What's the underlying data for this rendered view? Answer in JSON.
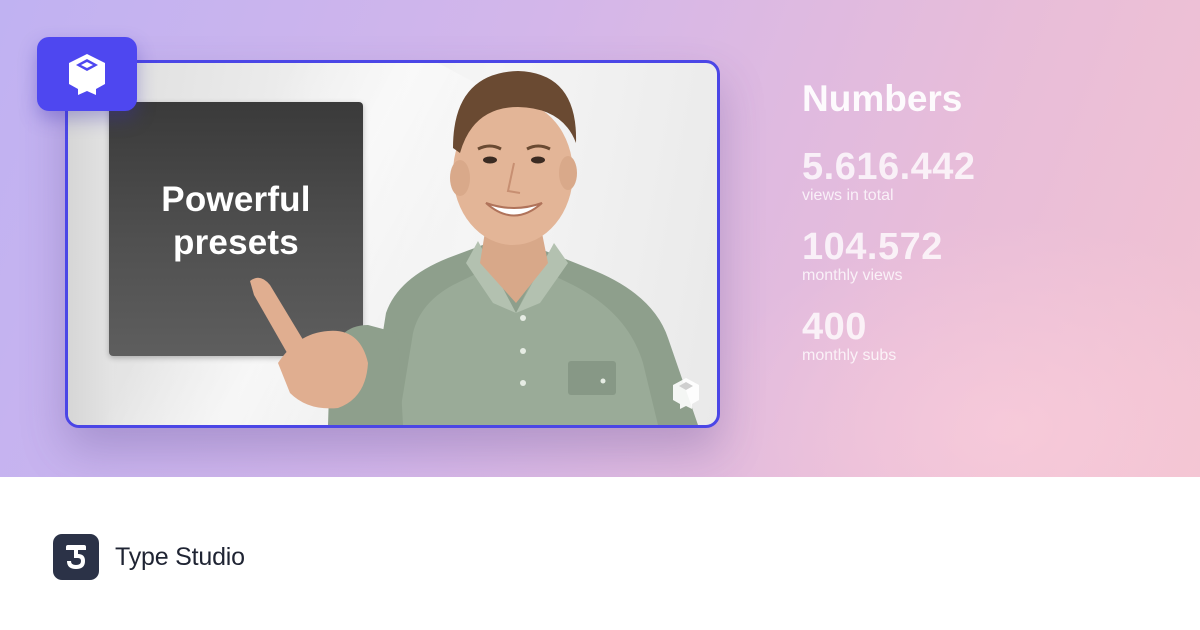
{
  "video": {
    "overlay_text_line1": "Powerful",
    "overlay_text_line2": "presets",
    "frame_color": "#4b46e6"
  },
  "brand_badge": {
    "icon": "type-studio-cube-icon",
    "color": "#4e47f0"
  },
  "stats": {
    "title": "Numbers",
    "items": [
      {
        "value": "5.616.442",
        "label": "views in total"
      },
      {
        "value": "104.572",
        "label": "monthly views"
      },
      {
        "value": "400",
        "label": "monthly subs"
      }
    ]
  },
  "footer": {
    "logo_icon": "type-studio-logo-icon",
    "brand_name": "Type Studio"
  }
}
